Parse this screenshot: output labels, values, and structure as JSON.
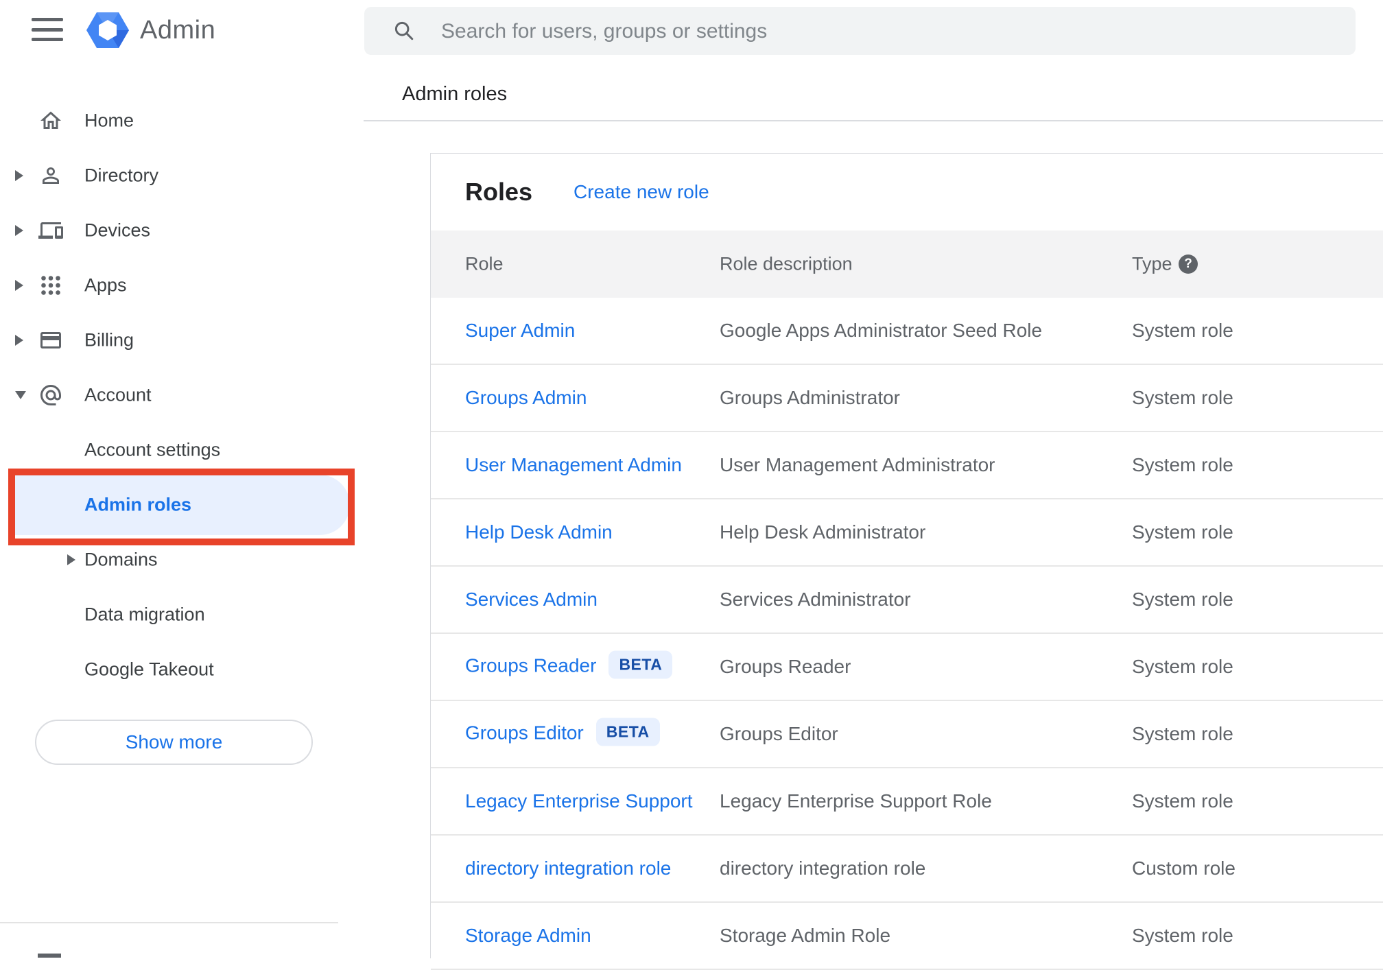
{
  "app": {
    "name": "Admin"
  },
  "topbar": {
    "search_placeholder": "Search for users, groups or settings"
  },
  "breadcrumb": "Admin roles",
  "sidebar": {
    "items": [
      {
        "label": "Home",
        "icon": "home-icon",
        "type": "main",
        "expand": null
      },
      {
        "label": "Directory",
        "icon": "person-icon",
        "type": "main",
        "expand": "collapsed"
      },
      {
        "label": "Devices",
        "icon": "devices-icon",
        "type": "main",
        "expand": "collapsed"
      },
      {
        "label": "Apps",
        "icon": "apps-grid-icon",
        "type": "main",
        "expand": "collapsed"
      },
      {
        "label": "Billing",
        "icon": "credit-card-icon",
        "type": "main",
        "expand": "collapsed"
      },
      {
        "label": "Account",
        "icon": "at-sign-icon",
        "type": "main",
        "expand": "expanded"
      },
      {
        "label": "Account settings",
        "type": "sub",
        "expand": null
      },
      {
        "label": "Admin roles",
        "type": "sub",
        "expand": null,
        "selected": true,
        "annotated": true
      },
      {
        "label": "Domains",
        "type": "sub",
        "expand": "collapsed"
      },
      {
        "label": "Data migration",
        "type": "sub",
        "expand": null
      },
      {
        "label": "Google Takeout",
        "type": "sub",
        "expand": null
      }
    ],
    "show_more_label": "Show more"
  },
  "main": {
    "card_title": "Roles",
    "create_link": "Create new role",
    "beta_badge_label": "BETA",
    "table": {
      "columns": [
        "Role",
        "Role description",
        "Type"
      ],
      "rows": [
        {
          "role": "Super Admin",
          "beta": false,
          "description": "Google Apps Administrator Seed Role",
          "type": "System role"
        },
        {
          "role": "Groups Admin",
          "beta": false,
          "description": "Groups Administrator",
          "type": "System role"
        },
        {
          "role": "User Management Admin",
          "beta": false,
          "description": "User Management Administrator",
          "type": "System role"
        },
        {
          "role": "Help Desk Admin",
          "beta": false,
          "description": "Help Desk Administrator",
          "type": "System role"
        },
        {
          "role": "Services Admin",
          "beta": false,
          "description": "Services Administrator",
          "type": "System role"
        },
        {
          "role": "Groups Reader",
          "beta": true,
          "description": "Groups Reader",
          "type": "System role"
        },
        {
          "role": "Groups Editor",
          "beta": true,
          "description": "Groups Editor",
          "type": "System role"
        },
        {
          "role": "Legacy Enterprise Support",
          "beta": false,
          "description": "Legacy Enterprise Support Role",
          "type": "System role"
        },
        {
          "role": "directory integration role",
          "beta": false,
          "description": "directory integration role",
          "type": "Custom role"
        },
        {
          "role": "Storage Admin",
          "beta": false,
          "description": "Storage Admin Role",
          "type": "System role"
        }
      ]
    }
  },
  "colors": {
    "accent_blue": "#1a73e8",
    "annotation_red": "#e8432a",
    "highlight_blue": "#e8f0fe",
    "beta_text_blue": "#174ea6",
    "icon_gray": "#5f6368"
  }
}
